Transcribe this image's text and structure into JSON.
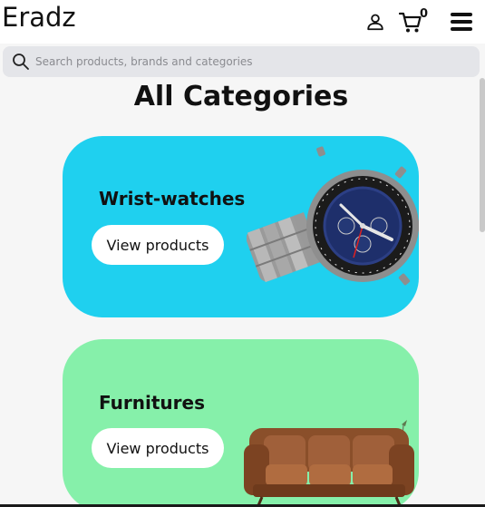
{
  "header": {
    "logo": "Eradz",
    "cart_count": "0"
  },
  "search": {
    "placeholder": "Search products, brands and categories"
  },
  "main": {
    "title": "All Categories",
    "categories": [
      {
        "name": "Wrist-watches",
        "button": "View products",
        "bg_color": "#1fd0ef",
        "image": "wristwatch"
      },
      {
        "name": "Furnitures",
        "button": "View products",
        "bg_color": "#86f0aa",
        "image": "sofa"
      }
    ]
  }
}
